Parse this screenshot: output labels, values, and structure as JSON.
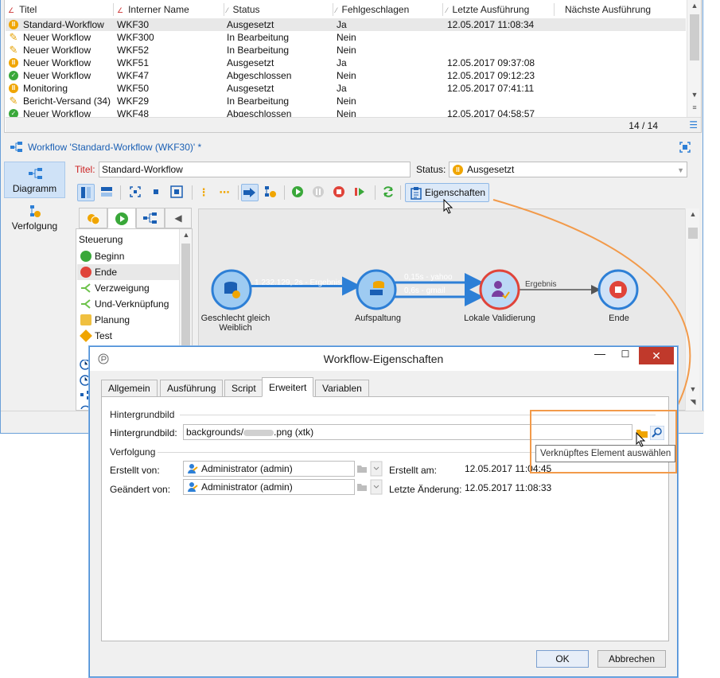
{
  "list": {
    "columns": [
      "Titel",
      "Interner Name",
      "Status",
      "Fehlgeschlagen",
      "Letzte Ausführung",
      "Nächste Ausführung"
    ],
    "rows": [
      {
        "title": "Standard-Workflow",
        "internal": "WKF30",
        "status": "Ausgesetzt",
        "failed": "Ja",
        "last": "12.05.2017 11:08:34",
        "next": "",
        "icon": "paused"
      },
      {
        "title": "Neuer Workflow",
        "internal": "WKF300",
        "status": "In Bearbeitung",
        "failed": "Nein",
        "last": "",
        "next": "",
        "icon": "edit"
      },
      {
        "title": "Neuer Workflow",
        "internal": "WKF52",
        "status": "In Bearbeitung",
        "failed": "Nein",
        "last": "",
        "next": "",
        "icon": "edit"
      },
      {
        "title": "Neuer Workflow",
        "internal": "WKF51",
        "status": "Ausgesetzt",
        "failed": "Ja",
        "last": "12.05.2017 09:37:08",
        "next": "",
        "icon": "paused"
      },
      {
        "title": "Neuer Workflow",
        "internal": "WKF47",
        "status": "Abgeschlossen",
        "failed": "Nein",
        "last": "12.05.2017 09:12:23",
        "next": "",
        "icon": "done"
      },
      {
        "title": "Monitoring",
        "internal": "WKF50",
        "status": "Ausgesetzt",
        "failed": "Ja",
        "last": "12.05.2017 07:41:11",
        "next": "",
        "icon": "paused"
      },
      {
        "title": "Bericht-Versand (34)",
        "internal": "WKF29",
        "status": "In Bearbeitung",
        "failed": "Nein",
        "last": "",
        "next": "",
        "icon": "edit"
      },
      {
        "title": "Neuer Workflow",
        "internal": "WKF48",
        "status": "Abgeschlossen",
        "failed": "Nein",
        "last": "12.05.2017 04:58:57",
        "next": "",
        "icon": "done"
      }
    ],
    "count": "14 / 14"
  },
  "workflow": {
    "header": "Workflow 'Standard-Workflow (WKF30)' *",
    "title_label": "Titel:",
    "title_value": "Standard-Workflow",
    "status_label": "Status:",
    "status_value": "Ausgesetzt"
  },
  "sidetabs": {
    "diagram": "Diagramm",
    "tracking": "Verfolgung"
  },
  "toolbar": {
    "properties": "Eigenschaften"
  },
  "palette": {
    "heading": "Steuerung",
    "items": [
      "Beginn",
      "Ende",
      "Verzweigung",
      "Und-Verknüpfung",
      "Planung",
      "Test"
    ]
  },
  "diagram": {
    "nodes": [
      "Geschlecht gleich Weiblich",
      "Aufspaltung",
      "Lokale Validierung",
      "Ende"
    ],
    "node_line1": "Geschlecht gleich",
    "node_line2": "Weiblich",
    "edges": [
      "1.232.129, 2s - Ergebnis",
      "0,15s - yahoo",
      "0,6s - gmail",
      "Ergebnis"
    ]
  },
  "dialog": {
    "title": "Workflow-Eigenschaften",
    "tabs": [
      "Allgemein",
      "Ausführung",
      "Script",
      "Erweitert",
      "Variablen"
    ],
    "active_tab": "Erweitert",
    "group_background": "Hintergrundbild",
    "bg_label": "Hintergrundbild:",
    "bg_prefix": "backgrounds/",
    "bg_suffix": ".png (xtk)",
    "group_tracking": "Verfolgung",
    "created_by_label": "Erstellt von:",
    "created_by": "Administrator (admin)",
    "created_at_label": "Erstellt am:",
    "created_at": "12.05.2017 11:04:45",
    "modified_by_label": "Geändert von:",
    "modified_by": "Administrator (admin)",
    "modified_at_label": "Letzte Änderung:",
    "modified_at": "12.05.2017 11:08:33",
    "ok": "OK",
    "cancel": "Abbrechen",
    "tooltip": "Verknüpftes Element auswählen"
  },
  "colors": {
    "accent": "#2d7fd6",
    "paused": "#f0a500",
    "done": "#3aa83a",
    "highlight": "#f29a4a",
    "close": "#c0392b"
  }
}
